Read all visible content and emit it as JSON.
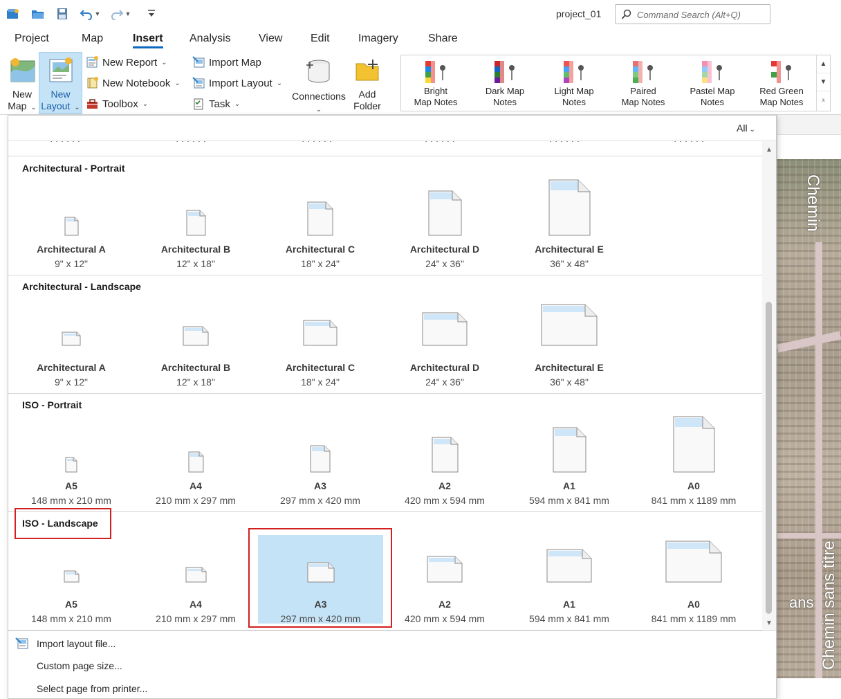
{
  "window": {
    "project_name": "project_01"
  },
  "search": {
    "placeholder": "Command Search (Alt+Q)"
  },
  "quick_access": [
    "project-icon",
    "open-icon",
    "save-icon",
    "undo-icon",
    "redo-icon",
    "customize-icon"
  ],
  "tabs": [
    {
      "label": "Project",
      "active": false
    },
    {
      "label": "Map",
      "active": false
    },
    {
      "label": "Insert",
      "active": true
    },
    {
      "label": "Analysis",
      "active": false
    },
    {
      "label": "View",
      "active": false
    },
    {
      "label": "Edit",
      "active": false
    },
    {
      "label": "Imagery",
      "active": false
    },
    {
      "label": "Share",
      "active": false
    }
  ],
  "ribbon": {
    "new_map": {
      "line1": "New",
      "line2": "Map"
    },
    "new_layout": {
      "line1": "New",
      "line2": "Layout"
    },
    "new_report": "New Report",
    "new_notebook": "New Notebook",
    "toolbox": "Toolbox",
    "import_map": "Import Map",
    "import_layout": "Import Layout",
    "task": "Task",
    "connections": "Connections",
    "add_folder": {
      "line1": "Add",
      "line2": "Folder"
    },
    "gallery": [
      {
        "line1": "Bright",
        "line2": "Map Notes",
        "colors": [
          "#e53935",
          "#1e88e5",
          "#43a047",
          "#fdd835"
        ]
      },
      {
        "line1": "Dark Map",
        "line2": "Notes",
        "colors": [
          "#c62828",
          "#1565c0",
          "#2e7d32",
          "#6a1b9a"
        ]
      },
      {
        "line1": "Light Map",
        "line2": "Notes",
        "colors": [
          "#ef5350",
          "#42a5f5",
          "#66bb6a",
          "#ab47bc"
        ]
      },
      {
        "line1": "Paired",
        "line2": "Map Notes",
        "colors": [
          "#e57373",
          "#64b5f6",
          "#81c784",
          "#4caf50"
        ]
      },
      {
        "line1": "Pastel Map",
        "line2": "Notes",
        "colors": [
          "#f48fb1",
          "#90caf9",
          "#a5d6a7",
          "#ffe082"
        ]
      },
      {
        "line1": "Red Green",
        "line2": "Map Notes",
        "colors": [
          "#e53935",
          "#ffffff",
          "#43a047",
          "#ffffff"
        ]
      }
    ]
  },
  "dropdown": {
    "filter": "All",
    "sections": [
      {
        "title": "Architectural - Portrait",
        "orientation": "portrait",
        "items": [
          {
            "name": "Architectural A",
            "size": "9\" x 12\"",
            "scale": 0.32
          },
          {
            "name": "Architectural B",
            "size": "12\" x 18\"",
            "scale": 0.45
          },
          {
            "name": "Architectural C",
            "size": "18\" x 24\"",
            "scale": 0.6
          },
          {
            "name": "Architectural D",
            "size": "24\" x 36\"",
            "scale": 0.8
          },
          {
            "name": "Architectural E",
            "size": "36\" x 48\"",
            "scale": 1.0
          }
        ]
      },
      {
        "title": "Architectural - Landscape",
        "orientation": "landscape",
        "items": [
          {
            "name": "Architectural A",
            "size": "9\" x 12\"",
            "scale": 0.32
          },
          {
            "name": "Architectural B",
            "size": "12\" x 18\"",
            "scale": 0.45
          },
          {
            "name": "Architectural C",
            "size": "18\" x 24\"",
            "scale": 0.6
          },
          {
            "name": "Architectural D",
            "size": "24\" x 36\"",
            "scale": 0.8
          },
          {
            "name": "Architectural E",
            "size": "36\" x 48\"",
            "scale": 1.0
          }
        ]
      },
      {
        "title": "ISO - Portrait",
        "orientation": "portrait",
        "items": [
          {
            "name": "A5",
            "size": "148 mm x 210 mm",
            "scale": 0.26
          },
          {
            "name": "A4",
            "size": "210 mm x 297 mm",
            "scale": 0.36
          },
          {
            "name": "A3",
            "size": "297 mm x 420 mm",
            "scale": 0.48
          },
          {
            "name": "A2",
            "size": "420 mm x 594 mm",
            "scale": 0.62
          },
          {
            "name": "A1",
            "size": "594 mm x 841 mm",
            "scale": 0.8
          },
          {
            "name": "A0",
            "size": "841 mm x 1189 mm",
            "scale": 1.0
          }
        ]
      },
      {
        "title": "ISO - Landscape",
        "orientation": "landscape",
        "highlight_title": true,
        "items": [
          {
            "name": "A5",
            "size": "148 mm x 210 mm",
            "scale": 0.26
          },
          {
            "name": "A4",
            "size": "210 mm x 297 mm",
            "scale": 0.36
          },
          {
            "name": "A3",
            "size": "297 mm x 420 mm",
            "scale": 0.48,
            "selected": true
          },
          {
            "name": "A2",
            "size": "420 mm x 594 mm",
            "scale": 0.62
          },
          {
            "name": "A1",
            "size": "594 mm x 841 mm",
            "scale": 0.8
          },
          {
            "name": "A0",
            "size": "841 mm x 1189 mm",
            "scale": 1.0
          }
        ]
      }
    ],
    "footer": [
      "Import layout file...",
      "Custom page size...",
      "Select page from printer..."
    ]
  },
  "map": {
    "label_top": "Chemin",
    "label_bottom": "Chemin sans titre",
    "label_mid": "ans"
  }
}
